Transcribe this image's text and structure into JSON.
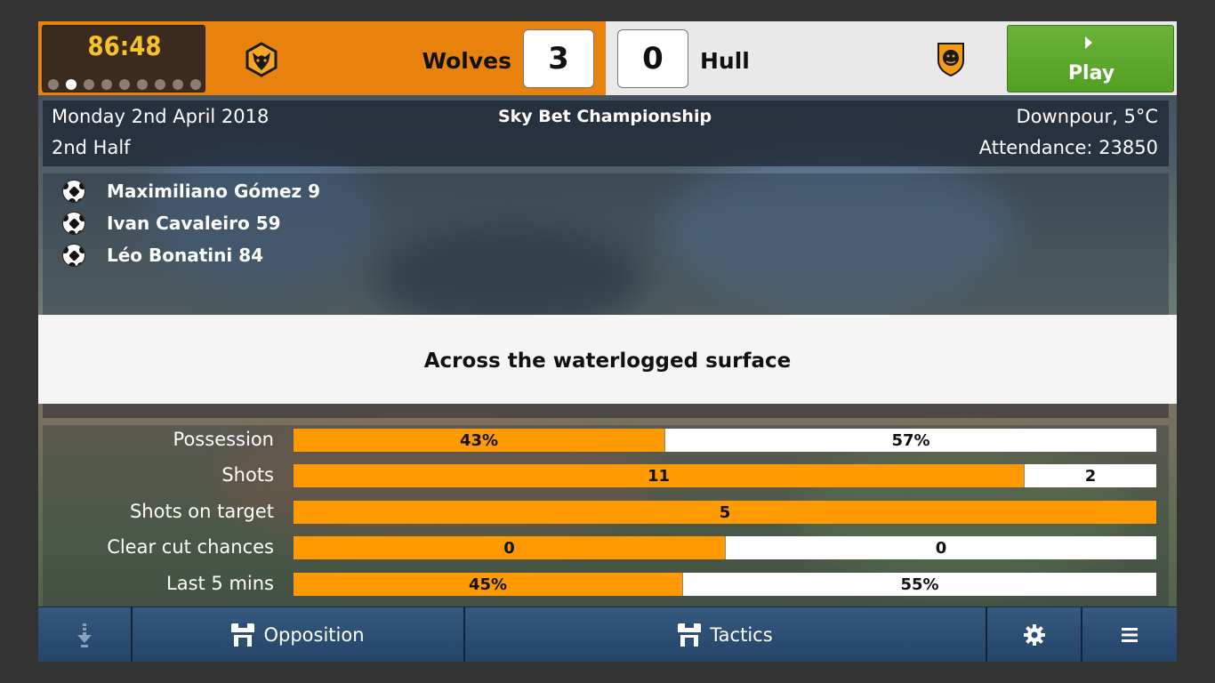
{
  "header": {
    "clock": "86:48",
    "clock_dots_total": 9,
    "clock_dot_active_index": 1,
    "home_team": "Wolves",
    "home_score": "3",
    "away_team": "Hull",
    "away_score": "0",
    "play_label": "Play",
    "home_color": "#e8820c",
    "play_color": "#5aab2a"
  },
  "info": {
    "date": "Monday 2nd April 2018",
    "half": "2nd Half",
    "competition": "Sky Bet Championship",
    "weather": "Downpour, 5°C",
    "attendance": "Attendance: 23850"
  },
  "goals": [
    {
      "text": "Maximiliano Gómez 9"
    },
    {
      "text": "Ivan Cavaleiro 59"
    },
    {
      "text": "Léo Bonatini 84"
    }
  ],
  "commentary": "Across the waterlogged surface",
  "stats": [
    {
      "label": "Possession",
      "home": "43%",
      "away": "57%",
      "home_share": 0.43
    },
    {
      "label": "Shots",
      "home": "11",
      "away": "2",
      "home_share": 0.846
    },
    {
      "label": "Shots on target",
      "home": "5",
      "away": "",
      "home_share": 1.0
    },
    {
      "label": "Clear cut chances",
      "home": "0",
      "away": "0",
      "home_share": 0.5
    },
    {
      "label": "Last 5 mins",
      "home": "45%",
      "away": "55%",
      "home_share": 0.45
    }
  ],
  "nav": {
    "download_icon": "download-icon",
    "opposition_label": "Opposition",
    "tactics_label": "Tactics",
    "settings_icon": "gear-icon",
    "menu_icon": "hamburger-menu-icon"
  }
}
